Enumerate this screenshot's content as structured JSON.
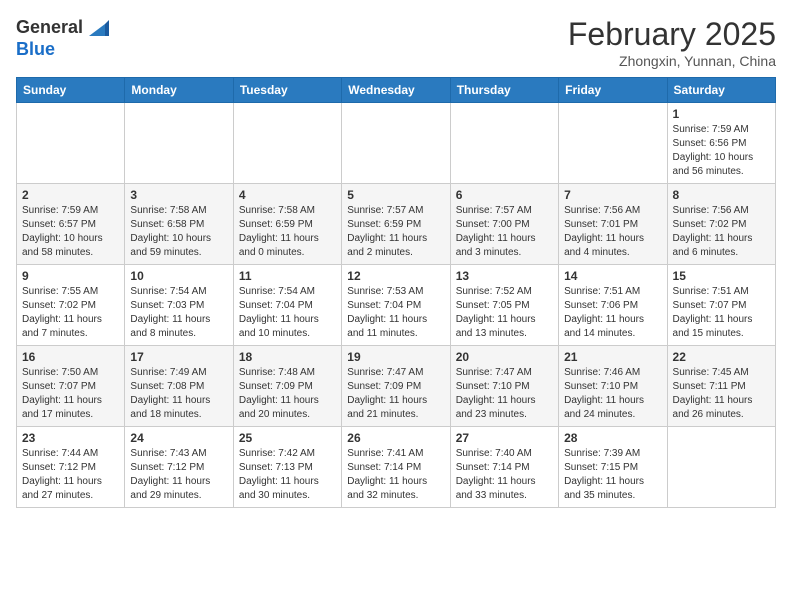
{
  "header": {
    "logo_general": "General",
    "logo_blue": "Blue",
    "month_year": "February 2025",
    "location": "Zhongxin, Yunnan, China"
  },
  "days_of_week": [
    "Sunday",
    "Monday",
    "Tuesday",
    "Wednesday",
    "Thursday",
    "Friday",
    "Saturday"
  ],
  "weeks": [
    [
      {
        "day": "",
        "info": ""
      },
      {
        "day": "",
        "info": ""
      },
      {
        "day": "",
        "info": ""
      },
      {
        "day": "",
        "info": ""
      },
      {
        "day": "",
        "info": ""
      },
      {
        "day": "",
        "info": ""
      },
      {
        "day": "1",
        "info": "Sunrise: 7:59 AM\nSunset: 6:56 PM\nDaylight: 10 hours and 56 minutes."
      }
    ],
    [
      {
        "day": "2",
        "info": "Sunrise: 7:59 AM\nSunset: 6:57 PM\nDaylight: 10 hours and 58 minutes."
      },
      {
        "day": "3",
        "info": "Sunrise: 7:58 AM\nSunset: 6:58 PM\nDaylight: 10 hours and 59 minutes."
      },
      {
        "day": "4",
        "info": "Sunrise: 7:58 AM\nSunset: 6:59 PM\nDaylight: 11 hours and 0 minutes."
      },
      {
        "day": "5",
        "info": "Sunrise: 7:57 AM\nSunset: 6:59 PM\nDaylight: 11 hours and 2 minutes."
      },
      {
        "day": "6",
        "info": "Sunrise: 7:57 AM\nSunset: 7:00 PM\nDaylight: 11 hours and 3 minutes."
      },
      {
        "day": "7",
        "info": "Sunrise: 7:56 AM\nSunset: 7:01 PM\nDaylight: 11 hours and 4 minutes."
      },
      {
        "day": "8",
        "info": "Sunrise: 7:56 AM\nSunset: 7:02 PM\nDaylight: 11 hours and 6 minutes."
      }
    ],
    [
      {
        "day": "9",
        "info": "Sunrise: 7:55 AM\nSunset: 7:02 PM\nDaylight: 11 hours and 7 minutes."
      },
      {
        "day": "10",
        "info": "Sunrise: 7:54 AM\nSunset: 7:03 PM\nDaylight: 11 hours and 8 minutes."
      },
      {
        "day": "11",
        "info": "Sunrise: 7:54 AM\nSunset: 7:04 PM\nDaylight: 11 hours and 10 minutes."
      },
      {
        "day": "12",
        "info": "Sunrise: 7:53 AM\nSunset: 7:04 PM\nDaylight: 11 hours and 11 minutes."
      },
      {
        "day": "13",
        "info": "Sunrise: 7:52 AM\nSunset: 7:05 PM\nDaylight: 11 hours and 13 minutes."
      },
      {
        "day": "14",
        "info": "Sunrise: 7:51 AM\nSunset: 7:06 PM\nDaylight: 11 hours and 14 minutes."
      },
      {
        "day": "15",
        "info": "Sunrise: 7:51 AM\nSunset: 7:07 PM\nDaylight: 11 hours and 15 minutes."
      }
    ],
    [
      {
        "day": "16",
        "info": "Sunrise: 7:50 AM\nSunset: 7:07 PM\nDaylight: 11 hours and 17 minutes."
      },
      {
        "day": "17",
        "info": "Sunrise: 7:49 AM\nSunset: 7:08 PM\nDaylight: 11 hours and 18 minutes."
      },
      {
        "day": "18",
        "info": "Sunrise: 7:48 AM\nSunset: 7:09 PM\nDaylight: 11 hours and 20 minutes."
      },
      {
        "day": "19",
        "info": "Sunrise: 7:47 AM\nSunset: 7:09 PM\nDaylight: 11 hours and 21 minutes."
      },
      {
        "day": "20",
        "info": "Sunrise: 7:47 AM\nSunset: 7:10 PM\nDaylight: 11 hours and 23 minutes."
      },
      {
        "day": "21",
        "info": "Sunrise: 7:46 AM\nSunset: 7:10 PM\nDaylight: 11 hours and 24 minutes."
      },
      {
        "day": "22",
        "info": "Sunrise: 7:45 AM\nSunset: 7:11 PM\nDaylight: 11 hours and 26 minutes."
      }
    ],
    [
      {
        "day": "23",
        "info": "Sunrise: 7:44 AM\nSunset: 7:12 PM\nDaylight: 11 hours and 27 minutes."
      },
      {
        "day": "24",
        "info": "Sunrise: 7:43 AM\nSunset: 7:12 PM\nDaylight: 11 hours and 29 minutes."
      },
      {
        "day": "25",
        "info": "Sunrise: 7:42 AM\nSunset: 7:13 PM\nDaylight: 11 hours and 30 minutes."
      },
      {
        "day": "26",
        "info": "Sunrise: 7:41 AM\nSunset: 7:14 PM\nDaylight: 11 hours and 32 minutes."
      },
      {
        "day": "27",
        "info": "Sunrise: 7:40 AM\nSunset: 7:14 PM\nDaylight: 11 hours and 33 minutes."
      },
      {
        "day": "28",
        "info": "Sunrise: 7:39 AM\nSunset: 7:15 PM\nDaylight: 11 hours and 35 minutes."
      },
      {
        "day": "",
        "info": ""
      }
    ]
  ]
}
